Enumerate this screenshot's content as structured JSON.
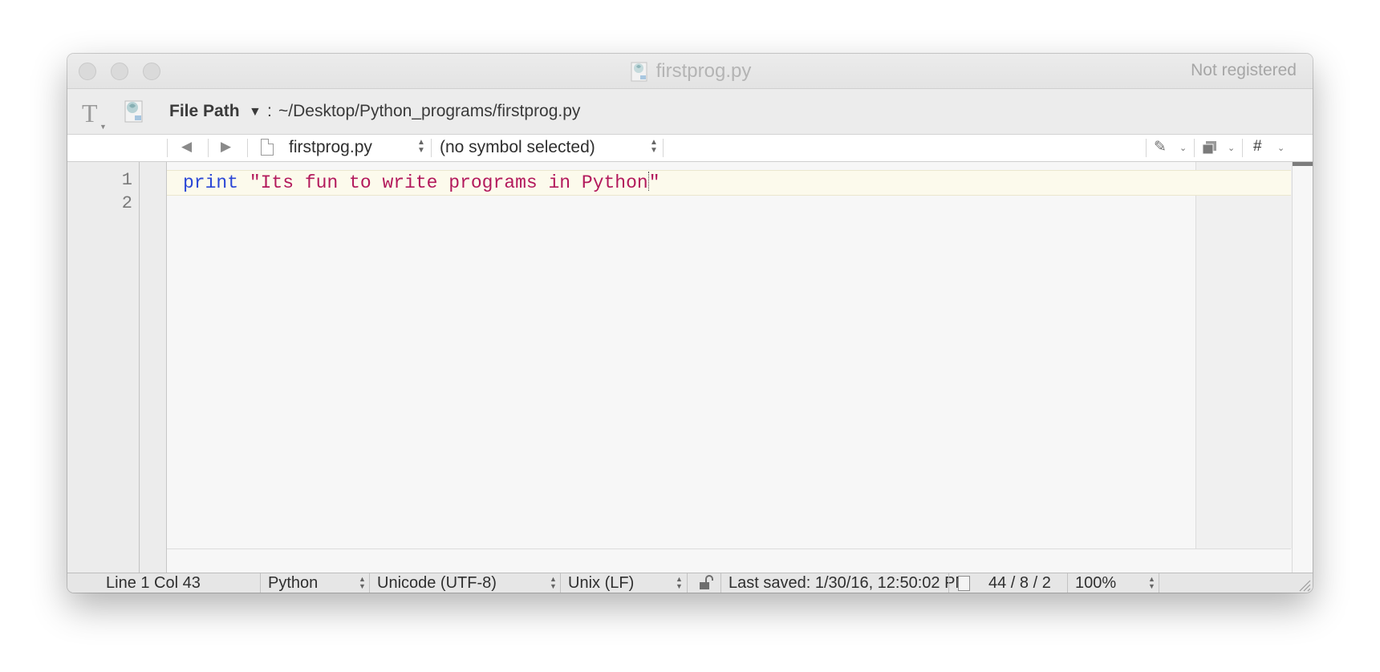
{
  "window": {
    "title": "firstprog.py",
    "registration": "Not registered"
  },
  "pathbar": {
    "label": "File Path",
    "colon": ":",
    "value": "~/Desktop/Python_programs/firstprog.py"
  },
  "navbar": {
    "back_icon": "◀",
    "forward_icon": "▶",
    "file_name": "firstprog.py",
    "symbol": "(no symbol selected)",
    "marker_icon": "✎",
    "hash_label": "#"
  },
  "editor": {
    "line_numbers": [
      "1",
      "2"
    ],
    "code": {
      "keyword": "print",
      "space": " ",
      "string_body": "\"Its fun to write programs in Python",
      "string_end": "\""
    },
    "colors": {
      "keyword": "#2b47d6",
      "string": "#b3195c",
      "current_line": "#fcfaec"
    }
  },
  "status": {
    "position": "Line 1 Col 43",
    "language": "Python",
    "encoding": "Unicode (UTF-8)",
    "line_endings": "Unix (LF)",
    "last_saved": "Last saved: 1/30/16, 12:50:02 PM",
    "counts": "44 / 8 / 2",
    "zoom": "100%"
  }
}
